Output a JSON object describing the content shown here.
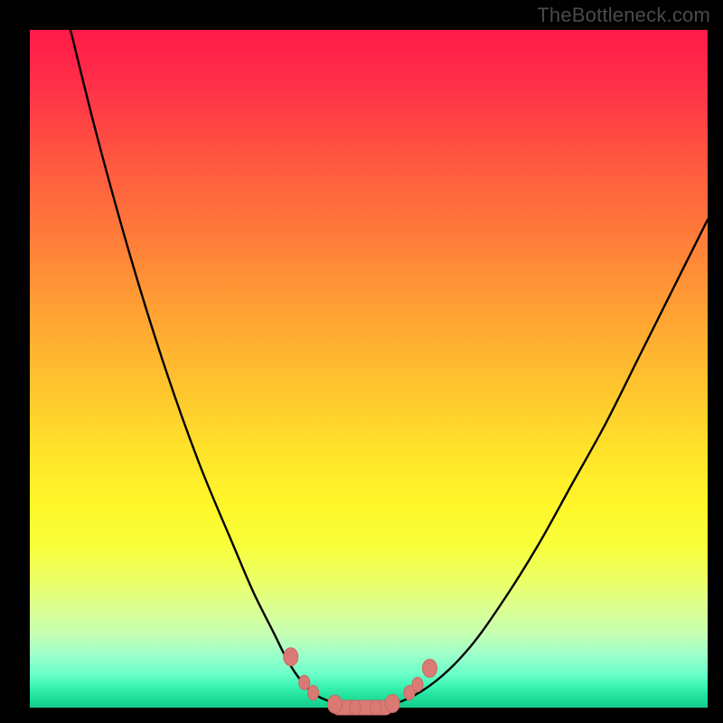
{
  "watermark": "TheBottleneck.com",
  "colors": {
    "frame": "#000000",
    "curve": "#000000",
    "marker_fill": "#d97a74",
    "marker_stroke": "#c96862",
    "gradient_top": "#ff1a47",
    "gradient_bottom": "#14cd8b"
  },
  "chart_data": {
    "type": "line",
    "title": "",
    "xlabel": "",
    "ylabel": "",
    "xlim": [
      0,
      100
    ],
    "ylim": [
      0,
      100
    ],
    "grid": false,
    "legend": false,
    "series": [
      {
        "name": "bottleneck-curve",
        "x": [
          6,
          10,
          15,
          20,
          25,
          30,
          33,
          36,
          38,
          40,
          42,
          44,
          47,
          50,
          55,
          60,
          65,
          70,
          75,
          80,
          85,
          90,
          95,
          100
        ],
        "y": [
          100,
          84,
          66,
          50,
          36,
          24,
          17,
          11,
          7,
          4,
          2,
          1,
          0,
          0,
          1,
          4,
          9,
          16,
          24,
          33,
          42,
          52,
          62,
          72
        ]
      }
    ],
    "markers": [
      {
        "x": 38.5,
        "y": 7.5
      },
      {
        "x": 40.5,
        "y": 3.7
      },
      {
        "x": 41.8,
        "y": 2.2
      },
      {
        "x": 45.0,
        "y": 0.5
      },
      {
        "x": 48.0,
        "y": 0.0
      },
      {
        "x": 51.0,
        "y": 0.0
      },
      {
        "x": 53.5,
        "y": 0.6
      },
      {
        "x": 56.0,
        "y": 2.2
      },
      {
        "x": 57.2,
        "y": 3.4
      },
      {
        "x": 59.0,
        "y": 5.8
      }
    ],
    "marker_bar": {
      "x0": 44.5,
      "x1": 53.5,
      "y": 0.0
    }
  }
}
